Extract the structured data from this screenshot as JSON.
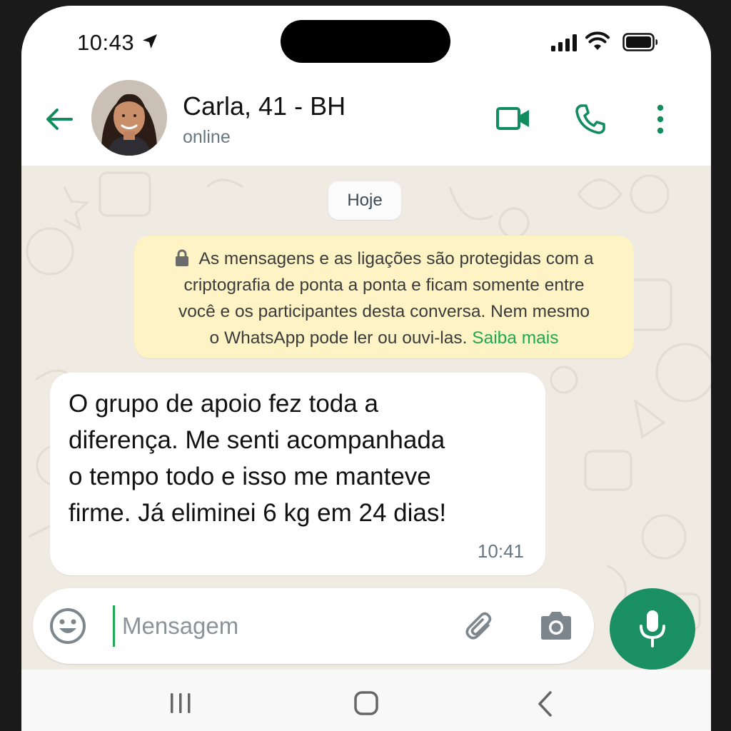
{
  "status_bar": {
    "time": "10:43"
  },
  "header": {
    "contact_name": "Carla, 41 - BH",
    "contact_status": "online"
  },
  "chat": {
    "date_chip": "Hoje",
    "encryption_notice": {
      "lines": [
        "As mensagens e as ligações são protegidas com a",
        "criptografia de ponta a ponta e ficam somente entre",
        "você e os participantes desta conversa. Nem mesmo",
        "o WhatsApp pode ler ou ouvi-las."
      ],
      "learn_more": "Saiba mais"
    },
    "messages": [
      {
        "lines": [
          "O grupo de apoio fez toda a",
          "diferença. Me senti acompanhada",
          "o tempo todo e isso me manteve",
          "firme. Já eliminei 6 kg em 24 dias!"
        ],
        "time": "10:41"
      }
    ]
  },
  "composer": {
    "placeholder": "Mensagem",
    "value": ""
  },
  "icons": {
    "back": "arrow-left-icon",
    "video": "video-camera-icon",
    "call": "phone-icon",
    "menu": "more-vertical-icon",
    "emoji": "emoji-icon",
    "attach": "paperclip-icon",
    "camera": "camera-icon",
    "mic": "microphone-icon"
  },
  "colors": {
    "accent": "#1a8f63",
    "link": "#1fa855",
    "chat_background": "#efeae2",
    "notice_background": "#fdf3c5",
    "bubble_background": "#ffffff"
  }
}
